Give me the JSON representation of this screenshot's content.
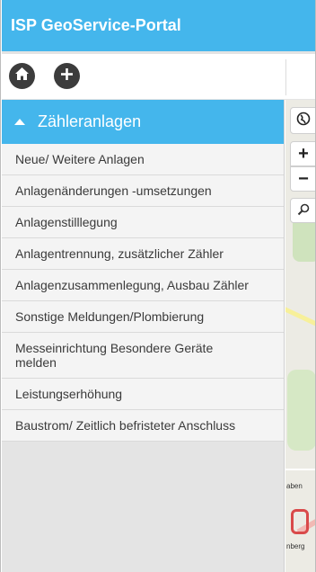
{
  "app": {
    "title": "ISP GeoService-Portal"
  },
  "toolbar": {
    "home_icon": "home-icon",
    "add_icon": "plus-icon"
  },
  "menu": {
    "section_title": "Zähleranlagen",
    "items": [
      {
        "label": "Neue/ Weitere Anlagen"
      },
      {
        "label": "Anlagenänderungen -umsetzungen"
      },
      {
        "label": "Anlagenstilllegung"
      },
      {
        "label": "Anlagentrennung, zusätzlicher Zähler"
      },
      {
        "label": "Anlagenzusammenlegung, Ausbau Zähler"
      },
      {
        "label": "Sonstige Meldungen/Plombierung"
      },
      {
        "label": "Messeinrichtung Besondere Geräte melden"
      },
      {
        "label": "Leistungserhöhung"
      },
      {
        "label": "Baustrom/ Zeitlich befristeter Anschluss"
      }
    ]
  },
  "map": {
    "zoom_in": "+",
    "zoom_out": "−",
    "label_1": "aben",
    "label_2": "nberg"
  },
  "colors": {
    "accent": "#44b6ec",
    "menu_bg": "#f4f4f4",
    "sidebar_bg": "#e4e4e4"
  }
}
